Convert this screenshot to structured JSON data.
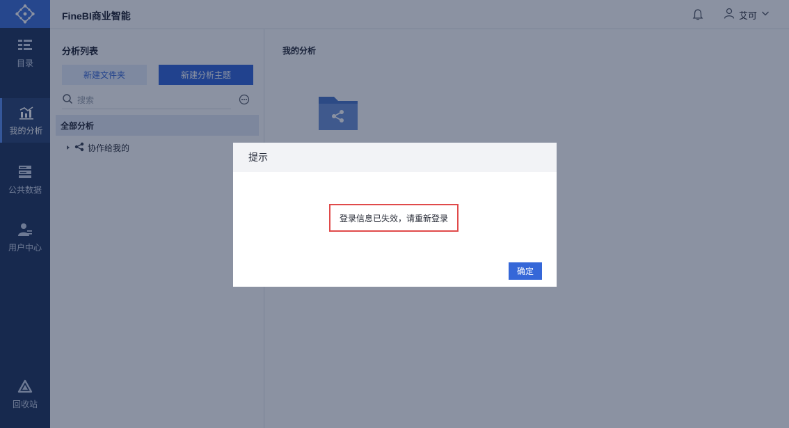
{
  "header": {
    "app_title": "FineBI商业智能",
    "user_name": "艾可"
  },
  "sidebar": {
    "items": [
      {
        "label": "目录",
        "icon": "catalog-icon"
      },
      {
        "label": "我的分析",
        "icon": "analysis-chart-icon"
      },
      {
        "label": "公共数据",
        "icon": "public-data-icon"
      },
      {
        "label": "用户中心",
        "icon": "user-center-icon"
      }
    ],
    "active_index": 1,
    "bottom": {
      "label": "回收站",
      "icon": "recycle-bin-icon"
    }
  },
  "left_panel": {
    "title": "分析列表",
    "new_folder_label": "新建文件夹",
    "new_subject_label": "新建分析主题",
    "search_placeholder": "搜索",
    "all_label": "全部分析",
    "tree": [
      {
        "label": "协作给我的"
      }
    ]
  },
  "main": {
    "title": "我的分析"
  },
  "dialog": {
    "title": "提示",
    "message": "登录信息已失效，请重新登录",
    "confirm_label": "确定"
  },
  "colors": {
    "sidebar_bg": "#21365e",
    "accent": "#3567d8",
    "highlight_border": "#e04a4a"
  }
}
